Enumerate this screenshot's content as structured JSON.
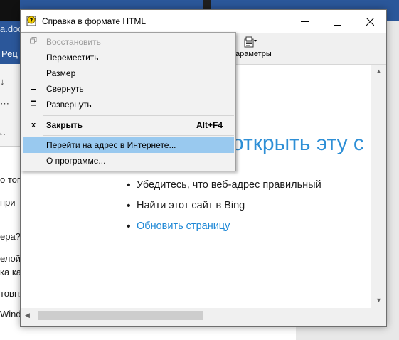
{
  "background_app": {
    "title_fragment": "a.doc",
    "ribbon_tab_fragment": "Рец",
    "doc_lines": [
      "о тог",
      "при",
      "ера?",
      "елой",
      "ка ка",
      "товня",
      "Windo"
    ]
  },
  "help_window": {
    "title": "Справка в формате HTML",
    "controls": {
      "minimize": "—",
      "maximize": "☐",
      "close": "✕"
    },
    "toolbar": {
      "options_label": "Параметры",
      "options_label_visible": "араметры"
    },
    "content": {
      "heading_visible": "открыть эту с",
      "bullets": [
        "Убедитесь, что веб-адрес правильный",
        "Найти этот сайт в Bing",
        "Обновить страницу"
      ]
    }
  },
  "system_menu": {
    "items": [
      {
        "label": "Восстановить",
        "icon": "restore-icon",
        "disabled": true
      },
      {
        "label": "Переместить"
      },
      {
        "label": "Размер"
      },
      {
        "label": "Свернуть",
        "icon": "minimize-icon"
      },
      {
        "label": "Развернуть",
        "icon": "maximize-icon"
      },
      {
        "label": "Закрыть",
        "icon": "close-icon",
        "shortcut": "Alt+F4"
      },
      {
        "label": "Перейти на адрес в Интернете...",
        "highlighted": true
      },
      {
        "label": "О программе..."
      }
    ]
  },
  "colors": {
    "word_blue": "#2b579a",
    "link_blue": "#2e8fd6",
    "menu_highlight": "#99c9ef"
  }
}
